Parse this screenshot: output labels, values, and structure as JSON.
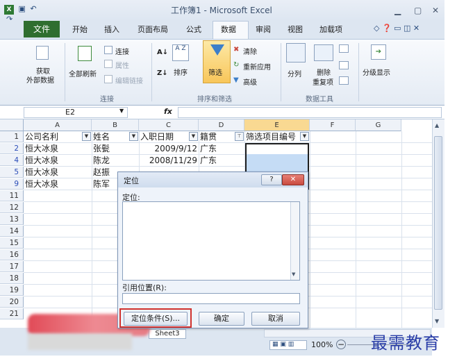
{
  "window": {
    "title": "工作簿1 - Microsoft Excel"
  },
  "tabs": [
    "文件",
    "开始",
    "插入",
    "页面布局",
    "公式",
    "数据",
    "审阅",
    "视图",
    "加载项"
  ],
  "ribbon": {
    "get_external_data": [
      "获取",
      "外部数据"
    ],
    "refresh_all": "全部刷新",
    "connections": "连接",
    "properties": "属性",
    "edit_links": "编辑链接",
    "connections_group": "连接",
    "sort": "排序",
    "filter": "筛选",
    "clear": "清除",
    "reapply": "重新应用",
    "advanced": "高级",
    "sort_filter_group": "排序和筛选",
    "text_to_columns": "分列",
    "remove_duplicates": [
      "删除",
      "重复项"
    ],
    "data_tools_group": "数据工具",
    "outline": "分级显示"
  },
  "formula_bar": {
    "name_box": "E2",
    "fx": "fx",
    "value": ""
  },
  "columns": [
    "A",
    "B",
    "C",
    "D",
    "E",
    "F",
    "G"
  ],
  "header_row": {
    "row": "1",
    "a": "公司名利",
    "b": "姓名",
    "c": "入职日期",
    "d": "籍贯",
    "e": "筛选项目编号"
  },
  "rows": [
    {
      "row": "2",
      "a": "恒大冰泉",
      "b": "张甏",
      "c": "2009/9/12",
      "d": "广东"
    },
    {
      "row": "4",
      "a": "恒大冰泉",
      "b": "陈龙",
      "c": "2008/11/29",
      "d": "广东"
    },
    {
      "row": "5",
      "a": "恒大冰泉",
      "b": "赵振",
      "c": "",
      "d": ""
    },
    {
      "row": "9",
      "a": "恒大冰泉",
      "b": "陈军",
      "c": "",
      "d": ""
    }
  ],
  "empty_rows": [
    "11",
    "12",
    "13",
    "14",
    "15",
    "16",
    "17",
    "18",
    "19",
    "20",
    "21"
  ],
  "dialog": {
    "title": "定位",
    "list_label": "定位:",
    "reference_label": "引用位置(R):",
    "reference_value": "",
    "special_button": "定位条件(S)...",
    "ok_button": "确定",
    "cancel_button": "取消",
    "help": "?",
    "close": "✕"
  },
  "status": {
    "sheet_tab": "Sheet3",
    "zoom": "100%"
  },
  "watermark": "最需教育",
  "colors": {
    "accent_green": "#2f6e2f",
    "selection": "#c5dcf5",
    "dialog_close": "#c94a3f",
    "highlight_outline": "#d0312d"
  }
}
